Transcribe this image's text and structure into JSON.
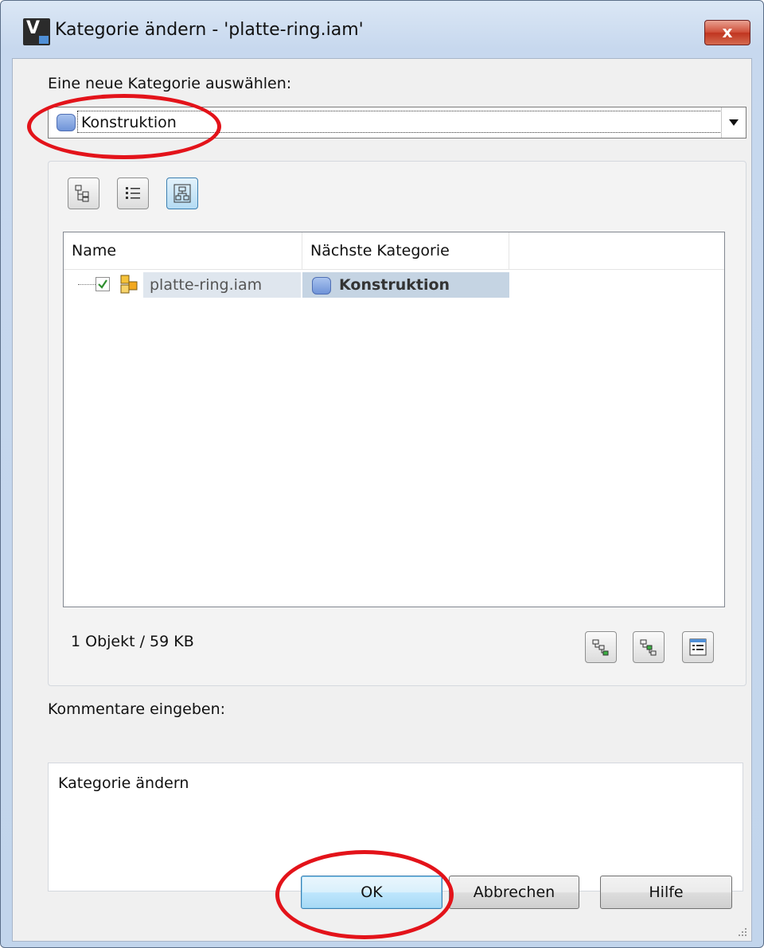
{
  "window": {
    "title": "Kategorie ändern - 'platte-ring.iam'",
    "close_label": "x"
  },
  "category_select": {
    "label": "Eine neue Kategorie auswählen:",
    "selected": "Konstruktion"
  },
  "list": {
    "columns": [
      "Name",
      "Nächste Kategorie"
    ],
    "rows": [
      {
        "name": "platte-ring.iam",
        "category": "Konstruktion",
        "checked": true
      }
    ],
    "status": "1 Objekt / 59 KB"
  },
  "comment": {
    "label": "Kommentare eingeben:",
    "value": "Kategorie ändern"
  },
  "buttons": {
    "ok": "OK",
    "cancel": "Abbrechen",
    "help": "Hilfe"
  },
  "colors": {
    "annotation": "#e3131a",
    "category_icon": "#6f93d8"
  }
}
